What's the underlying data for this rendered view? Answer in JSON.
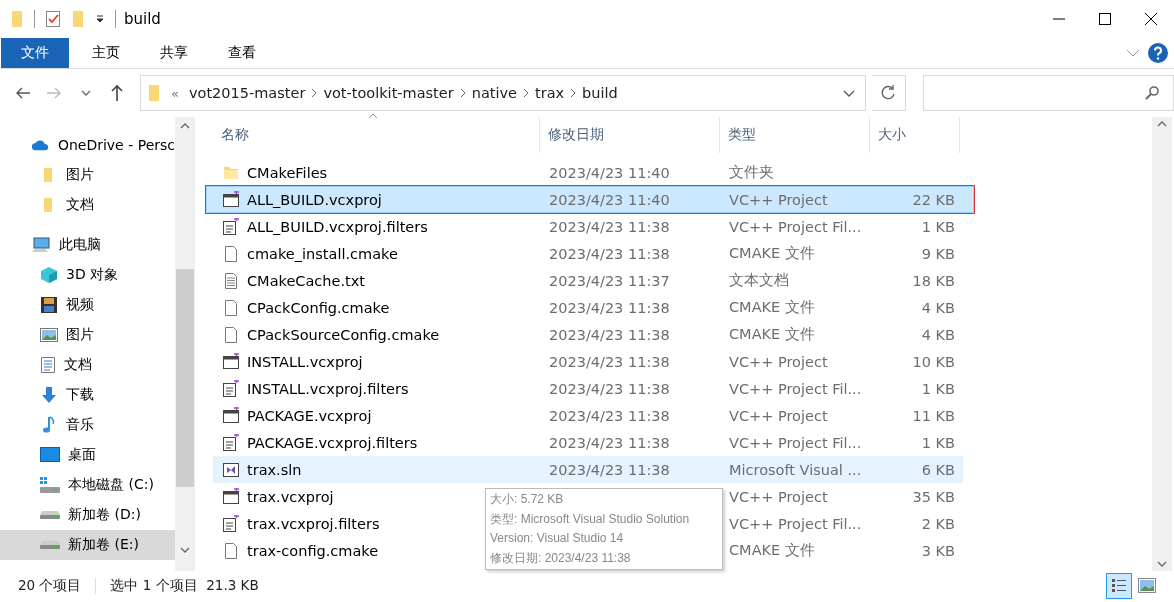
{
  "window": {
    "title": "build"
  },
  "ribbon_tabs": [
    {
      "label": "文件",
      "selected": true
    },
    {
      "label": "主页",
      "selected": false
    },
    {
      "label": "共享",
      "selected": false
    },
    {
      "label": "查看",
      "selected": false
    }
  ],
  "address": {
    "overflow": "«",
    "crumbs": [
      "vot2015-master",
      "vot-toolkit-master",
      "native",
      "trax",
      "build"
    ]
  },
  "sidebar": {
    "items": [
      {
        "label": "OneDrive - Persc",
        "kind": "cloud",
        "selected": false,
        "children": [
          {
            "label": "图片",
            "kind": "folder",
            "selected": false
          },
          {
            "label": "文档",
            "kind": "folder",
            "selected": false
          }
        ]
      },
      {
        "label": "此电脑",
        "kind": "pc",
        "selected": false,
        "children": [
          {
            "label": "3D 对象",
            "kind": "cube",
            "selected": false
          },
          {
            "label": "视频",
            "kind": "video",
            "selected": false
          },
          {
            "label": "图片",
            "kind": "image",
            "selected": false
          },
          {
            "label": "文档",
            "kind": "doc",
            "selected": false
          },
          {
            "label": "下载",
            "kind": "download",
            "selected": false
          },
          {
            "label": "音乐",
            "kind": "music",
            "selected": false
          },
          {
            "label": "桌面",
            "kind": "desktop",
            "selected": false
          },
          {
            "label": "本地磁盘 (C:)",
            "kind": "sysdrive",
            "selected": false
          },
          {
            "label": "新加卷 (D:)",
            "kind": "drive",
            "selected": false
          },
          {
            "label": "新加卷 (E:)",
            "kind": "drive",
            "selected": true
          }
        ]
      }
    ]
  },
  "table": {
    "columns": [
      "名称",
      "修改日期",
      "类型",
      "大小"
    ],
    "rows": [
      {
        "name": "CMakeFiles",
        "kind": "folder",
        "date": "2023/4/23 11:40",
        "type": "文件夹",
        "size": "",
        "selected": false,
        "hovered": false
      },
      {
        "name": "ALL_BUILD.vcxproj",
        "kind": "vcxproj",
        "date": "2023/4/23 11:40",
        "type": "VC++ Project",
        "size": "22 KB",
        "selected": true,
        "hovered": false
      },
      {
        "name": "ALL_BUILD.vcxproj.filters",
        "kind": "filters",
        "date": "2023/4/23 11:38",
        "type": "VC++ Project Fil...",
        "size": "1 KB",
        "selected": false,
        "hovered": false
      },
      {
        "name": "cmake_install.cmake",
        "kind": "blank",
        "date": "2023/4/23 11:38",
        "type": "CMAKE 文件",
        "size": "9 KB",
        "selected": false,
        "hovered": false
      },
      {
        "name": "CMakeCache.txt",
        "kind": "text",
        "date": "2023/4/23 11:37",
        "type": "文本文档",
        "size": "18 KB",
        "selected": false,
        "hovered": false
      },
      {
        "name": "CPackConfig.cmake",
        "kind": "blank",
        "date": "2023/4/23 11:38",
        "type": "CMAKE 文件",
        "size": "4 KB",
        "selected": false,
        "hovered": false
      },
      {
        "name": "CPackSourceConfig.cmake",
        "kind": "blank",
        "date": "2023/4/23 11:38",
        "type": "CMAKE 文件",
        "size": "4 KB",
        "selected": false,
        "hovered": false
      },
      {
        "name": "INSTALL.vcxproj",
        "kind": "vcxproj",
        "date": "2023/4/23 11:38",
        "type": "VC++ Project",
        "size": "10 KB",
        "selected": false,
        "hovered": false
      },
      {
        "name": "INSTALL.vcxproj.filters",
        "kind": "filters",
        "date": "2023/4/23 11:38",
        "type": "VC++ Project Fil...",
        "size": "1 KB",
        "selected": false,
        "hovered": false
      },
      {
        "name": "PACKAGE.vcxproj",
        "kind": "vcxproj",
        "date": "2023/4/23 11:38",
        "type": "VC++ Project",
        "size": "11 KB",
        "selected": false,
        "hovered": false
      },
      {
        "name": "PACKAGE.vcxproj.filters",
        "kind": "filters",
        "date": "2023/4/23 11:38",
        "type": "VC++ Project Fil...",
        "size": "1 KB",
        "selected": false,
        "hovered": false
      },
      {
        "name": "trax.sln",
        "kind": "sln",
        "date": "2023/4/23 11:38",
        "type": "Microsoft Visual ...",
        "size": "6 KB",
        "selected": false,
        "hovered": true
      },
      {
        "name": "trax.vcxproj",
        "kind": "vcxproj",
        "type": "VC++ Project",
        "size": "35 KB",
        "selected": false,
        "hovered": false
      },
      {
        "name": "trax.vcxproj.filters",
        "kind": "filters",
        "type": "VC++ Project Fil...",
        "size": "2 KB",
        "selected": false,
        "hovered": false
      },
      {
        "name": "trax-config.cmake",
        "kind": "blank",
        "type": "CMAKE 文件",
        "size": "3 KB",
        "selected": false,
        "hovered": false
      }
    ]
  },
  "tooltip": [
    "大小: 5.72 KB",
    "类型: Microsoft Visual Studio Solution",
    "Version: Visual Studio 14",
    "修改日期: 2023/4/23 11:38"
  ],
  "status_bar": {
    "count": "20 个项目",
    "selection": "选中 1 个项目  21.3 KB",
    "views": [
      {
        "kind": "details",
        "selected": true
      },
      {
        "kind": "large",
        "selected": false
      }
    ]
  }
}
